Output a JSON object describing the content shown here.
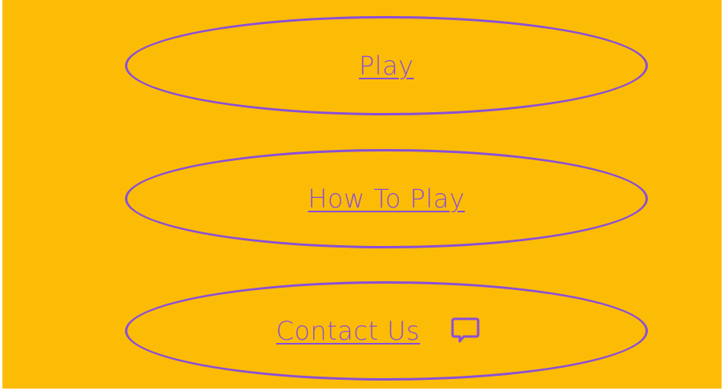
{
  "colors": {
    "background": "#fcbc05",
    "accent": "#8a4fd8",
    "frame": "#ffffff"
  },
  "menu": {
    "play_label": "Play",
    "how_to_play_label": "How To Play",
    "contact_label": "Contact Us",
    "contact_icon": "chat-bubble-icon"
  }
}
